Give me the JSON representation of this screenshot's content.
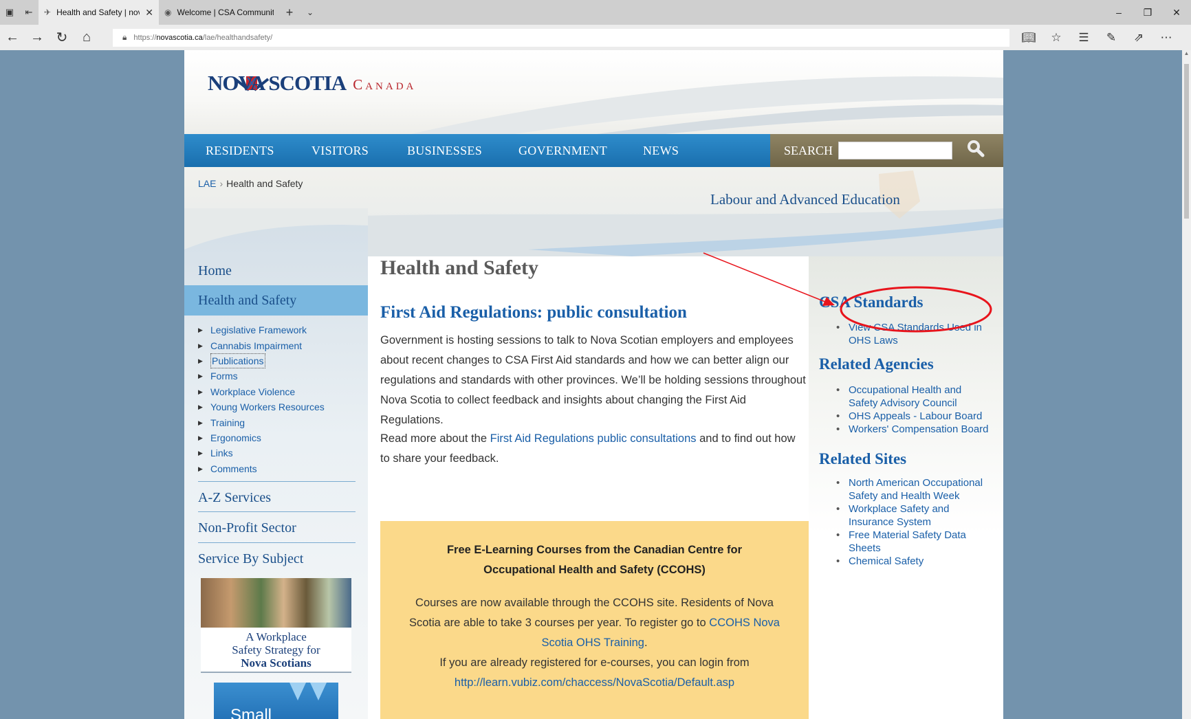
{
  "browser": {
    "tabs": [
      {
        "title": "Health and Safety | nova",
        "active": true
      },
      {
        "title": "Welcome | CSA Communitie",
        "active": false
      }
    ],
    "url_prefix": "https://",
    "url_domain": "novascotia.ca",
    "url_path": "/lae/healthandsafety/"
  },
  "header": {
    "logo_main": "NOVA SCOTIA",
    "logo_sub": "Canada"
  },
  "mainnav": {
    "items": [
      "RESIDENTS",
      "VISITORS",
      "BUSINESSES",
      "GOVERNMENT",
      "NEWS"
    ],
    "search_label": "SEARCH",
    "search_value": ""
  },
  "breadcrumb": {
    "root": "LAE",
    "separator": "›",
    "current": "Health and Safety"
  },
  "department": "Labour and Advanced Education",
  "sidebar": {
    "home": "Home",
    "active": "Health and Safety",
    "subitems": [
      "Legislative Framework",
      "Cannabis Impairment",
      "Publications",
      "Forms",
      "Workplace Violence",
      "Young Workers Resources",
      "Training",
      "Ergonomics",
      "Links",
      "Comments"
    ],
    "az": "A-Z Services",
    "nonprofit": "Non-Profit Sector",
    "subject": "Service By Subject",
    "promo_line1": "A Workplace",
    "promo_line2": "Safety Strategy for",
    "promo_line3": "Nova Scotians",
    "promo2_text": "Small"
  },
  "content": {
    "title": "Health and Safety",
    "subtitle": "First Aid Regulations: public consultation",
    "para1": "Government is hosting sessions to talk to Nova Scotian employers and employees about recent changes to CSA First Aid standards and how we can better align our regulations and standards with other provinces. We’ll be holding sessions throughout Nova Scotia to collect feedback and insights about changing the First Aid Regulations.",
    "para2_before": "Read more about the ",
    "para2_link": "First Aid Regulations public consultations",
    "para2_after": " and to find out how to share your feedback."
  },
  "notice": {
    "title": "Free E-Learning Courses from the Canadian Centre for Occupational Health and Safety (CCOHS)",
    "p1_before": "Courses are now available through the CCOHS site. Residents of Nova Scotia are able to take 3 courses per year. To register go to ",
    "p1_link": "CCOHS Nova Scotia OHS Training",
    "p1_after": ".",
    "p2_before": "If you are already registered for e-courses, you can login from",
    "p2_link": "http://learn.vubiz.com/chaccess/NovaScotia/Default.asp"
  },
  "rightcol": {
    "csa_heading": "CSA Standards",
    "csa_items": [
      "View CSA Standards Used in OHS Laws"
    ],
    "agencies_heading": "Related Agencies",
    "agencies_items": [
      "Occupational Health and Safety Advisory Council",
      "OHS Appeals - Labour Board",
      "Workers' Compensation Board"
    ],
    "sites_heading": "Related Sites",
    "sites_items": [
      "North American Occupational Safety and Health Week",
      "Workplace Safety and Insurance System",
      "Free Material Safety Data Sheets",
      "Chemical Safety"
    ]
  },
  "colors": {
    "nav_blue": "#1a6fae",
    "search_bg": "#7a6f52",
    "link": "#1a5fa8",
    "notice_bg": "#fbd98a",
    "annotation": "#e8141c"
  }
}
